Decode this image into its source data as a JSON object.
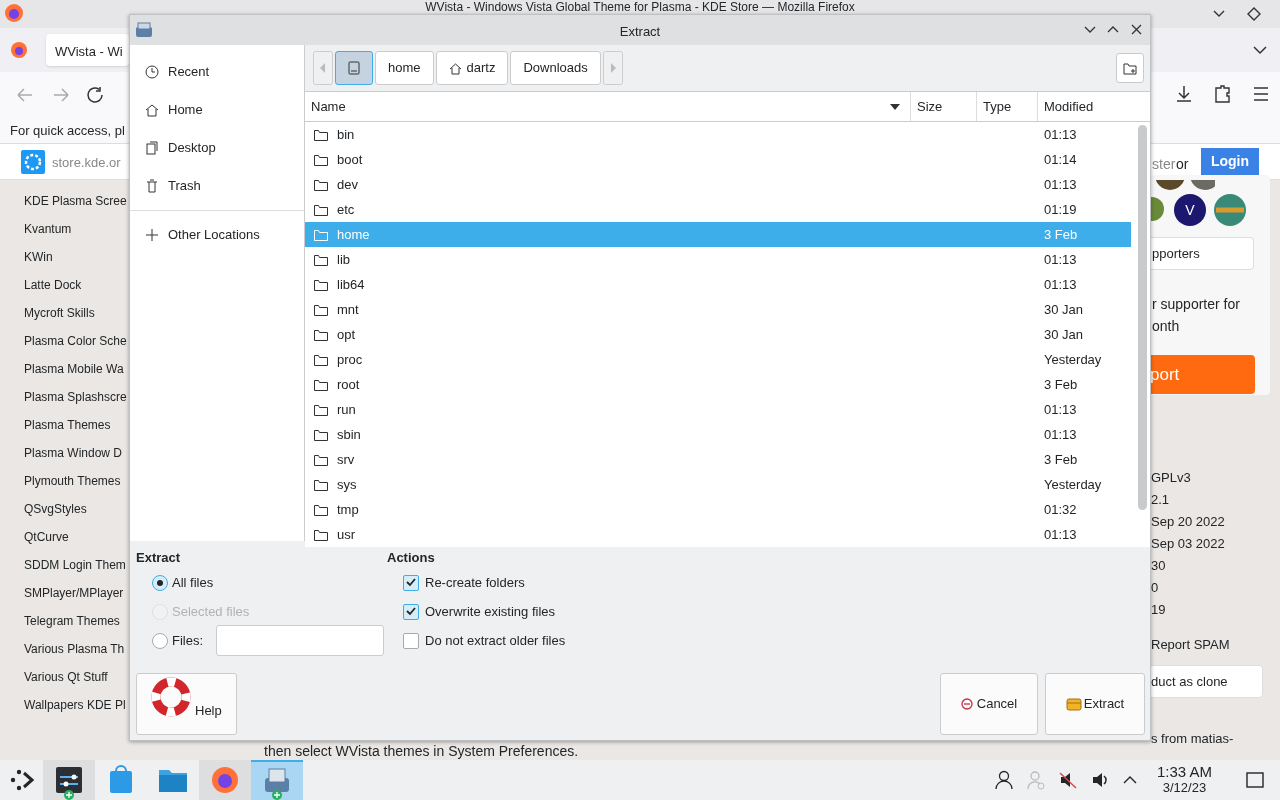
{
  "browser": {
    "window_title": "WVista - Windows Vista Global Theme for Plasma - KDE Store — Mozilla Firefox",
    "tab_title": "WVista - Wi",
    "notice": "For quick access, pl",
    "url": "store.kde.or",
    "categories": [
      "KDE Plasma Scree",
      "Kvantum",
      "KWin",
      "Latte Dock",
      "Mycroft Skills",
      "Plasma Color Sche",
      "Plasma Mobile Wa",
      "Plasma Splashscre",
      "Plasma Themes",
      "Plasma Window D",
      "Plymouth Themes",
      "QSvgStyles",
      "QtCurve",
      "SDDM Login Them",
      "SMPlayer/MPlayer",
      "Telegram Themes",
      "Various Plasma Th",
      "Various Qt Stuff",
      "Wallpapers KDE Pl"
    ],
    "register_link": "ster",
    "or": "or",
    "login_button": "Login",
    "avatar_letter": "V",
    "supporters_button": "pporters",
    "support_text": [
      "r supporter for",
      "onth"
    ],
    "support_button": "port",
    "details": [
      "GPLv3",
      "2.1",
      "Sep 20 2022",
      "Sep 03 2022",
      "30",
      "0",
      "19"
    ],
    "report_link": "Report SPAM",
    "clone_button": "duct as clone",
    "more_from": "s from matias-",
    "instructions": "then select WVista themes in System Preferences."
  },
  "dialog": {
    "title": "Extract",
    "places": [
      {
        "label": "Recent",
        "kind": "recent"
      },
      {
        "label": "Home",
        "kind": "home"
      },
      {
        "label": "Desktop",
        "kind": "desktop"
      },
      {
        "label": "Trash",
        "kind": "trash"
      },
      {
        "label": "Other Locations",
        "kind": "other"
      }
    ],
    "breadcrumb": [
      {
        "kind": "drive",
        "selected": true
      },
      {
        "label": "home",
        "kind": "folder",
        "selected": false
      },
      {
        "label": "dartz",
        "kind": "home",
        "selected": false
      },
      {
        "label": "Downloads",
        "kind": "folder",
        "selected": false
      }
    ],
    "columns": [
      "Name",
      "Size",
      "Type",
      "Modified"
    ],
    "rows": [
      {
        "name": "bin",
        "modified": "01:13",
        "selected": false
      },
      {
        "name": "boot",
        "modified": "01:14",
        "selected": false
      },
      {
        "name": "dev",
        "modified": "01:13",
        "selected": false
      },
      {
        "name": "etc",
        "modified": "01:19",
        "selected": false
      },
      {
        "name": "home",
        "modified": "3 Feb",
        "selected": true
      },
      {
        "name": "lib",
        "modified": "01:13",
        "selected": false
      },
      {
        "name": "lib64",
        "modified": "01:13",
        "selected": false
      },
      {
        "name": "mnt",
        "modified": "30 Jan",
        "selected": false
      },
      {
        "name": "opt",
        "modified": "30 Jan",
        "selected": false
      },
      {
        "name": "proc",
        "modified": "Yesterday",
        "selected": false
      },
      {
        "name": "root",
        "modified": "3 Feb",
        "selected": false
      },
      {
        "name": "run",
        "modified": "01:13",
        "selected": false
      },
      {
        "name": "sbin",
        "modified": "01:13",
        "selected": false
      },
      {
        "name": "srv",
        "modified": "3 Feb",
        "selected": false
      },
      {
        "name": "sys",
        "modified": "Yesterday",
        "selected": false
      },
      {
        "name": "tmp",
        "modified": "01:32",
        "selected": false
      },
      {
        "name": "usr",
        "modified": "01:13",
        "selected": false
      }
    ],
    "extract_group": {
      "title": "Extract",
      "options": [
        {
          "label": "All files",
          "selected": true,
          "disabled": false
        },
        {
          "label": "Selected files",
          "selected": false,
          "disabled": true
        },
        {
          "label": "Files:",
          "selected": false,
          "disabled": false
        }
      ]
    },
    "actions_group": {
      "title": "Actions",
      "options": [
        {
          "label": "Re-create folders",
          "checked": true
        },
        {
          "label": "Overwrite existing files",
          "checked": true
        },
        {
          "label": "Do not extract older files",
          "checked": false
        }
      ]
    },
    "help_button": "Help",
    "cancel_button": "Cancel",
    "extract_button": "Extract"
  },
  "taskbar": {
    "apps": [
      {
        "kind": "settings",
        "open": true,
        "active": false,
        "badge": true
      },
      {
        "kind": "store",
        "open": false,
        "active": false,
        "badge": false
      },
      {
        "kind": "files",
        "open": false,
        "active": false,
        "badge": false
      },
      {
        "kind": "browser",
        "open": true,
        "active": false,
        "badge": false
      },
      {
        "kind": "archiver",
        "open": true,
        "active": true,
        "badge": true
      }
    ],
    "time": "1:33 AM",
    "date": "3/12/23"
  }
}
